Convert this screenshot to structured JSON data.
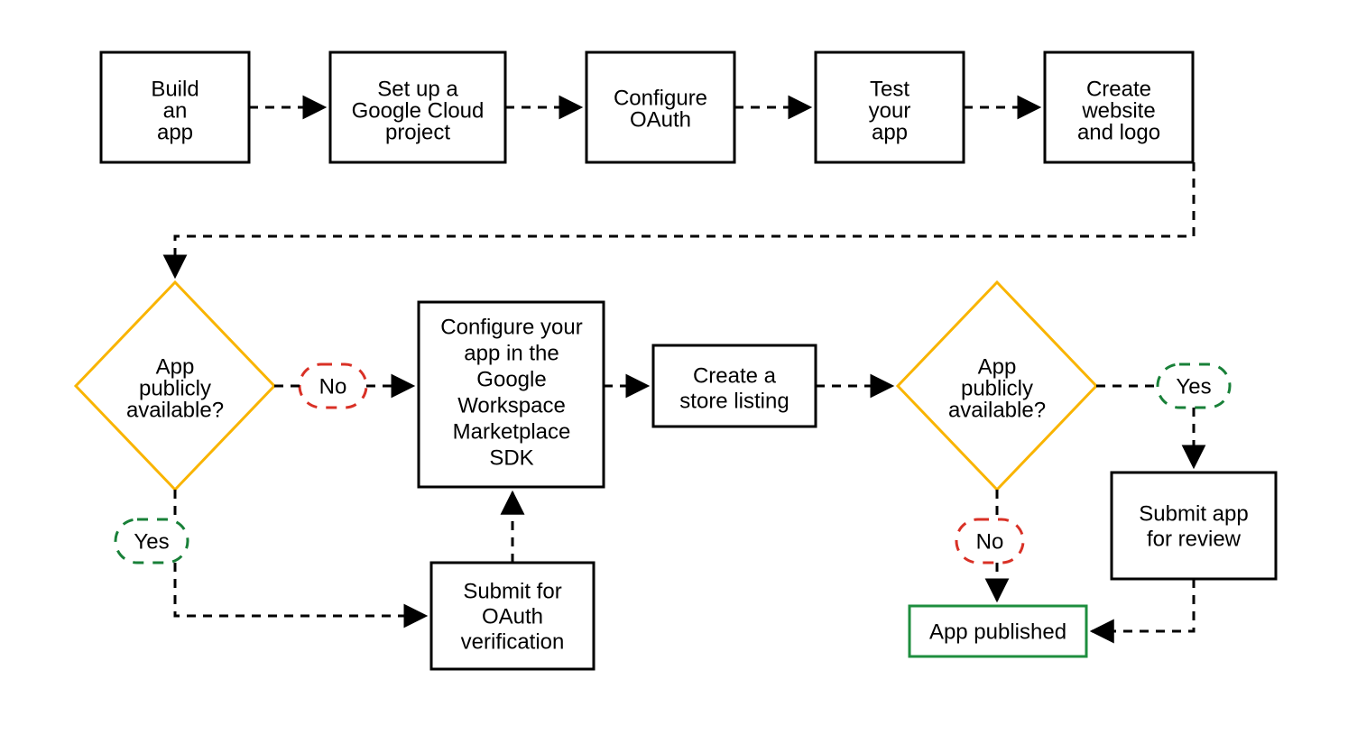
{
  "colors": {
    "border": "#000000",
    "diamond": "#f9b400",
    "yes": "#188038",
    "no": "#d93025",
    "end": "#1e8e3e",
    "dash": "#000000"
  },
  "boxes": {
    "build": {
      "l1": "Build",
      "l2": "an",
      "l3": "app"
    },
    "setup": {
      "l1": "Set up a",
      "l2": "Google Cloud",
      "l3": "project"
    },
    "oauth": {
      "l1": "Configure",
      "l2": "OAuth"
    },
    "test": {
      "l1": "Test",
      "l2": "your",
      "l3": "app"
    },
    "create": {
      "l1": "Create",
      "l2": "website",
      "l3": "and logo"
    },
    "config": {
      "l1": "Configure your",
      "l2": "app in the",
      "l3": "Google",
      "l4": "Workspace",
      "l5": "Marketplace",
      "l6": "SDK"
    },
    "store": {
      "l1": "Create a",
      "l2": "store listing"
    },
    "submitv": {
      "l1": "Submit for",
      "l2": "OAuth",
      "l3": "verification"
    },
    "submitr": {
      "l1": "Submit app",
      "l2": "for review"
    },
    "end": {
      "l1": "App published"
    }
  },
  "diamonds": {
    "d1": {
      "l1": "App",
      "l2": "publicly",
      "l3": "available?"
    },
    "d2": {
      "l1": "App",
      "l2": "publicly",
      "l3": "available?"
    }
  },
  "pills": {
    "yes1": "Yes",
    "no1": "No",
    "yes2": "Yes",
    "no2": "No"
  }
}
